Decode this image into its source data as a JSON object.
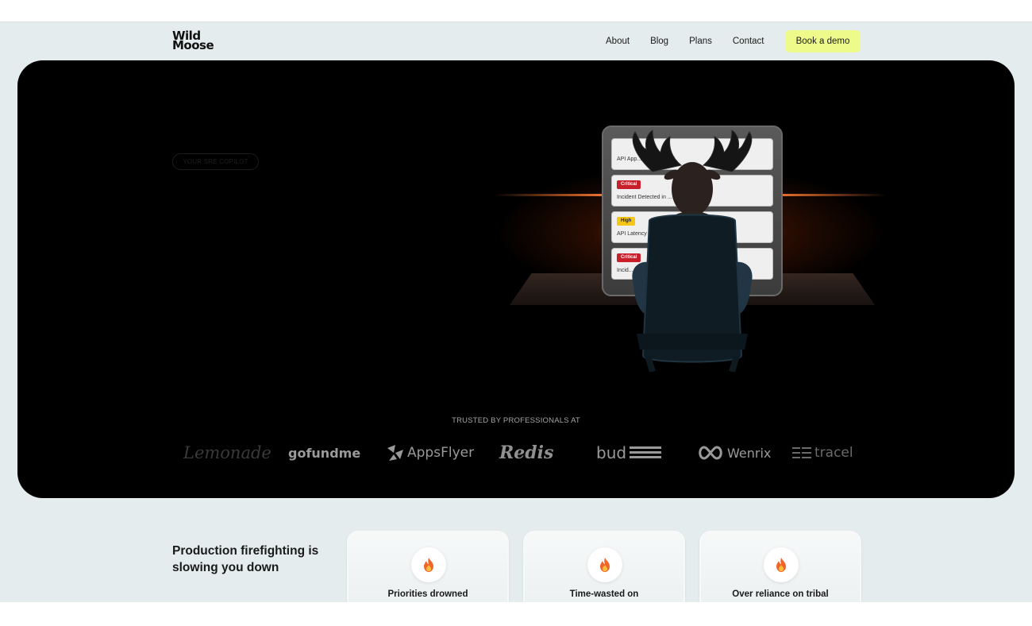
{
  "header": {
    "logo_line1": "Wild",
    "logo_line2": "Moose",
    "nav": [
      "About",
      "Blog",
      "Plans",
      "Contact"
    ],
    "cta": "Book a demo"
  },
  "hero": {
    "eyebrow": "YOUR SRE COPILOT",
    "incidents": [
      {
        "severity": "",
        "text": "API App... ent Detected"
      },
      {
        "severity": "Critical",
        "text": "Incident Detected in ... Buffering Spike"
      },
      {
        "severity": "High",
        "text": "API Latency"
      },
      {
        "severity": "Critical",
        "text": "Incid..."
      }
    ],
    "trusted_label": "TRUSTED BY PROFESSIONALS AT",
    "brands": [
      "Lemonade",
      "gofundme",
      "AppsFlyer",
      "Redis",
      "bud",
      "Wenrix",
      "tracel"
    ]
  },
  "problems": {
    "title": "Production firefighting is slowing you down",
    "cards": [
      {
        "icon": "fire-icon",
        "text": "Priorities drowned"
      },
      {
        "icon": "fire-icon",
        "text": "Time-wasted on"
      },
      {
        "icon": "fire-icon",
        "text": "Over reliance on tribal"
      }
    ]
  },
  "colors": {
    "background": "#e5eced",
    "hero": "#000000",
    "cta": "#eefb8a",
    "critical": "#c8202a",
    "high": "#f5c518",
    "glow": "#ff7a30"
  }
}
